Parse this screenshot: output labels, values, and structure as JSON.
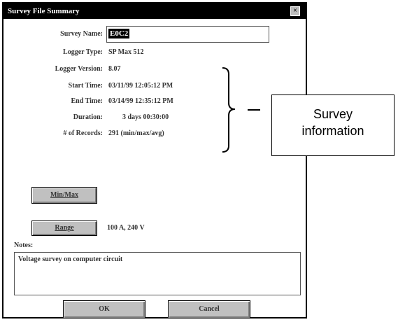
{
  "window": {
    "title": "Survey File Summary",
    "close_glyph": "×"
  },
  "fields": {
    "survey_name_label": "Survey Name:",
    "survey_name_value": "E0C2",
    "logger_type_label": "Logger Type:",
    "logger_type_value": "SP Max 512",
    "logger_version_label": "Logger Version:",
    "logger_version_value": "8.07",
    "start_time_label": "Start Time:",
    "start_time_value": "03/11/99  12:05:12 PM",
    "end_time_label": "End Time:",
    "end_time_value": "03/14/99  12:35:12 PM",
    "duration_label": "Duration:",
    "duration_value": "3 days 00:30:00",
    "records_label": "# of Records:",
    "records_value": "291 (min/max/avg)"
  },
  "buttons": {
    "minmax_label": "Min/Max",
    "range_label": "Range",
    "range_value": "100 A, 240 V",
    "ok_label": "OK",
    "cancel_label": "Cancel"
  },
  "notes": {
    "label": "Notes:",
    "text": "Voltage survey on computer circuit"
  },
  "annotation": {
    "line1": "Survey",
    "line2": "information"
  }
}
